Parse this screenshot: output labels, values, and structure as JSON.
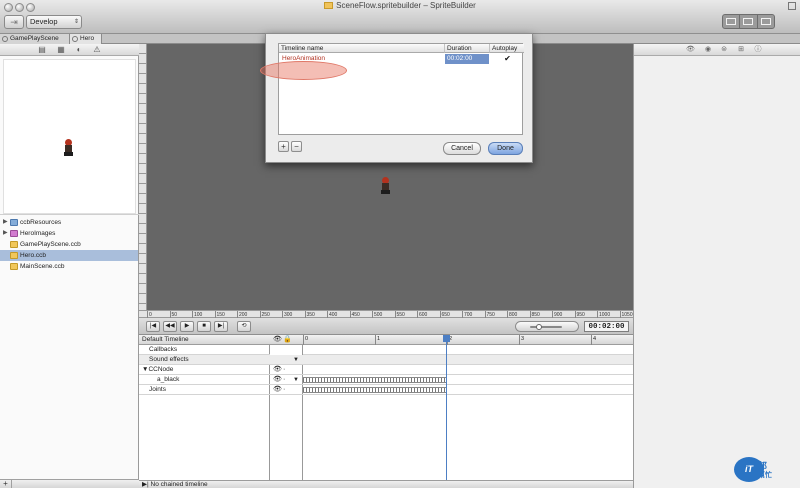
{
  "window": {
    "title": "SceneFlow.spritebuilder – SpriteBuilder"
  },
  "toolbar": {
    "target": "Develop",
    "run_icon": "run-icon"
  },
  "tabs": [
    {
      "label": "GamePlayScene"
    },
    {
      "label": "Hero"
    }
  ],
  "files": [
    {
      "label": "ccbResources",
      "type": "folder"
    },
    {
      "label": "HeroImages",
      "type": "image-folder"
    },
    {
      "label": "GamePlayScene.ccb",
      "type": "ccb"
    },
    {
      "label": "Hero.ccb",
      "type": "ccb",
      "selected": true
    },
    {
      "label": "MainScene.ccb",
      "type": "ccb"
    }
  ],
  "dialog": {
    "col_name": "Timeline name",
    "col_duration": "Duration",
    "col_autoplay": "Autoplay",
    "rows": [
      {
        "name": "HeroAnimation",
        "duration": "00:02:00",
        "autoplay": "✔"
      }
    ],
    "add": "+",
    "remove": "−",
    "cancel": "Cancel",
    "done": "Done"
  },
  "ruler_h": [
    "0",
    "50",
    "100",
    "150",
    "200",
    "250",
    "300",
    "350",
    "400",
    "450",
    "500",
    "550",
    "600",
    "650",
    "700",
    "750",
    "800",
    "850",
    "900",
    "950",
    "1000",
    "1050"
  ],
  "transport": {
    "buttons": [
      "|◀",
      "◀◀",
      "▶",
      "■",
      "▶|",
      "⟲"
    ],
    "time": "00:02:00"
  },
  "timeline": {
    "name": "Default Timeline",
    "rows": [
      "Callbacks",
      "Sound effects",
      "CCNode",
      "a_black",
      "Joints"
    ],
    "ruler": [
      "0",
      "1",
      "2",
      "3",
      "4"
    ],
    "chain": "No chained timeline"
  },
  "logo": {
    "bubble": "iT",
    "line1": "邦",
    "line2": "幫忙"
  },
  "colors": {
    "selection": "#a9bedb",
    "playhead": "#4d7fc4",
    "highlight_oval": "#e07868"
  }
}
